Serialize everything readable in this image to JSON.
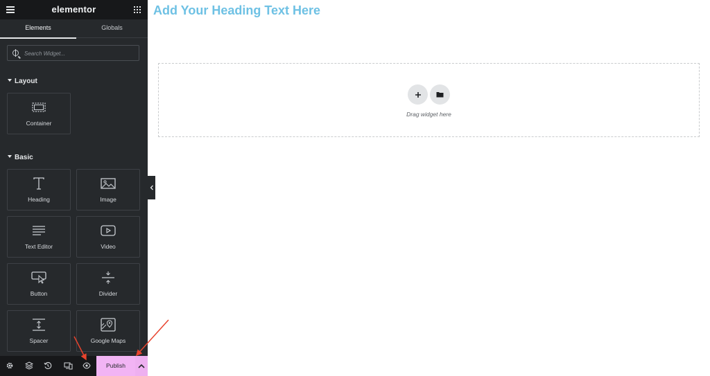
{
  "panel": {
    "logo": "elementor",
    "tabs": [
      {
        "label": "Elements"
      },
      {
        "label": "Globals"
      }
    ],
    "search": {
      "placeholder": "Search Widget..."
    },
    "sections": [
      {
        "title": "Layout",
        "widgets": [
          {
            "label": "Container",
            "icon": "container-icon"
          }
        ]
      },
      {
        "title": "Basic",
        "widgets": [
          {
            "label": "Heading",
            "icon": "heading-icon"
          },
          {
            "label": "Image",
            "icon": "image-icon"
          },
          {
            "label": "Text Editor",
            "icon": "text-editor-icon"
          },
          {
            "label": "Video",
            "icon": "video-icon"
          },
          {
            "label": "Button",
            "icon": "button-icon"
          },
          {
            "label": "Divider",
            "icon": "divider-icon"
          },
          {
            "label": "Spacer",
            "icon": "spacer-icon"
          },
          {
            "label": "Google Maps",
            "icon": "google-maps-icon"
          }
        ]
      }
    ]
  },
  "footer": {
    "icons": [
      "settings-icon",
      "navigator-layers-icon",
      "history-icon",
      "responsive-mode-icon",
      "preview-eye-icon"
    ],
    "publish_label": "Publish"
  },
  "canvas": {
    "heading": "Add Your Heading Text Here",
    "dropzone_text": "Drag widget here"
  },
  "colors": {
    "panel_bg": "#26292c",
    "heading": "#6ec1e4",
    "publish_bg": "#f2b4f4",
    "annotation_arrow": "#e8432d"
  }
}
